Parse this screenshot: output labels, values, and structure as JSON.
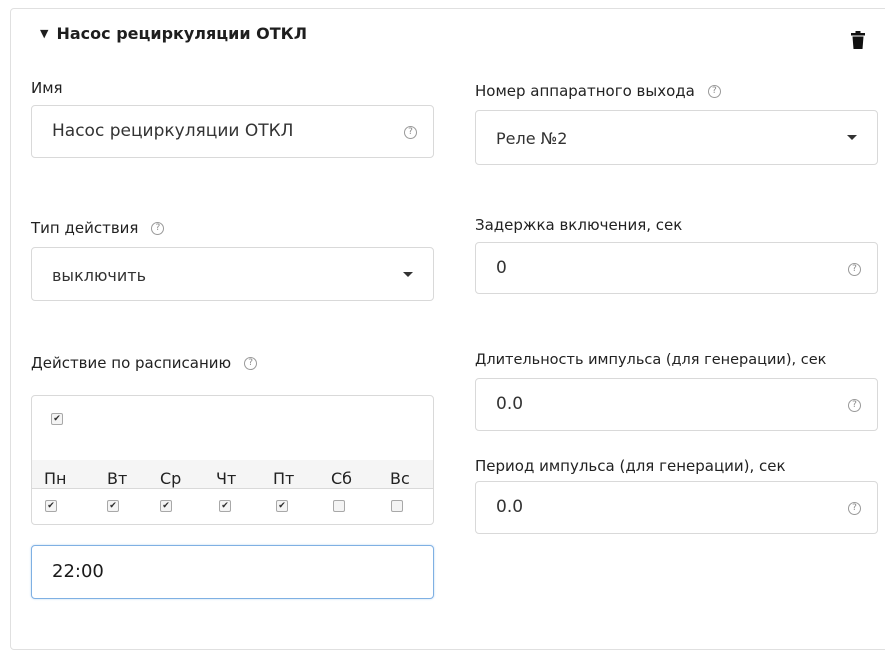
{
  "card": {
    "title": "Насос рециркуляции ОТКЛ",
    "collapse_icon": "caret-down-icon",
    "delete_icon": "trash-icon"
  },
  "name_field": {
    "label": "Имя",
    "value": "Насос рециркуляции ОТКЛ"
  },
  "hardware_output": {
    "label": "Номер аппаратного выхода",
    "value": "Реле №2"
  },
  "action_type": {
    "label": "Тип действия",
    "value": "выключить"
  },
  "enable_delay": {
    "label": "Задержка включения, сек",
    "value": "0"
  },
  "schedule": {
    "label": "Действие по расписанию",
    "enabled": true,
    "days": [
      {
        "label": "Пн",
        "checked": true
      },
      {
        "label": "Вт",
        "checked": true
      },
      {
        "label": "Ср",
        "checked": true
      },
      {
        "label": "Чт",
        "checked": true
      },
      {
        "label": "Пт",
        "checked": true
      },
      {
        "label": "Сб",
        "checked": false
      },
      {
        "label": "Вс",
        "checked": false
      }
    ],
    "time": "22:00"
  },
  "pulse_duration": {
    "label": "Длительность импульса (для генерации), сек",
    "value": "0.0"
  },
  "pulse_period": {
    "label": "Период импульса (для генерации), сек",
    "value": "0.0"
  },
  "help_glyph": "?",
  "check_glyph": "✔"
}
